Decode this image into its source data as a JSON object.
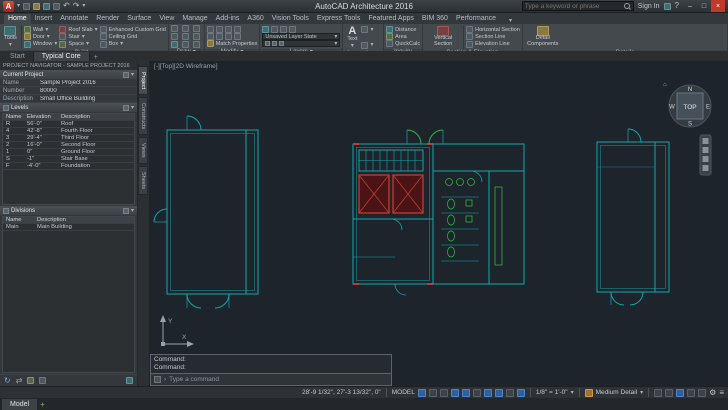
{
  "icons": {
    "caret": "▾",
    "minimize": "–",
    "maximize": "□",
    "close": "×",
    "home": "⌂",
    "gear": "⚙",
    "menu": "≡",
    "undo": "↶",
    "redo": "↷",
    "refresh": "↻",
    "sync": "⇄",
    "help": "?",
    "plus": "+",
    "prompt": "›",
    "logo": "A",
    "text_a": "A"
  },
  "titlebar": {
    "app_title": "AutoCAD Architecture 2016",
    "search_placeholder": "Type a keyword or phrase",
    "signin": "Sign In"
  },
  "ribbon": {
    "tabs": [
      "Home",
      "Insert",
      "Annotate",
      "Render",
      "Surface",
      "View",
      "Manage",
      "Add-ins",
      "A360",
      "Vision Tools",
      "Express Tools",
      "Featured Apps",
      "BIM 360",
      "Performance"
    ],
    "build": {
      "label": "Build",
      "tools": "Tools",
      "col1": [
        "Wall",
        "Door",
        "Window"
      ],
      "col2": [
        "Roof Slab",
        "Stair",
        "Space"
      ],
      "col3": [
        "Enhanced Custom Grid",
        "Ceiling Grid",
        "Box"
      ]
    },
    "draw": {
      "label": "Draw"
    },
    "modify": {
      "label": "Modify",
      "match": "Match Properties"
    },
    "layers": {
      "label": "Layers",
      "state": "Unsaved Layer State"
    },
    "annotation": {
      "label": "Annotation",
      "text_tool": "Text"
    },
    "inquiry": {
      "label": "Inquiry",
      "items": [
        "Distance",
        "Area",
        "QuickCalc"
      ]
    },
    "section": {
      "label": "Section & Elevation",
      "primary": "Vertical Section",
      "items": [
        "Horizontal Section",
        "Section Line",
        "Elevation Line"
      ]
    },
    "details": {
      "label": "Details",
      "primary": "Detail Components"
    }
  },
  "file_tabs": {
    "start": "Start",
    "active": "Typical Core"
  },
  "navigator": {
    "title": "PROJECT NAVIGATOR - SAMPLE PROJECT 2016",
    "tabs": [
      "Project",
      "Constructs",
      "Views",
      "Sheets"
    ],
    "current_project": {
      "header": "Current Project",
      "rows": [
        [
          "Name",
          "Sample Project 2016"
        ],
        [
          "Number",
          "80000"
        ],
        [
          "Description",
          "Small Office Building"
        ]
      ]
    },
    "levels": {
      "header": "Levels",
      "columns": [
        "Name",
        "Elevation",
        "Description"
      ],
      "rows": [
        [
          "R",
          "56'-0\"",
          "Roof"
        ],
        [
          "4",
          "42'-8\"",
          "Fourth Floor"
        ],
        [
          "3",
          "29'-4\"",
          "Third Floor"
        ],
        [
          "2",
          "16'-0\"",
          "Second Floor"
        ],
        [
          "1",
          "0\"",
          "Ground Floor"
        ],
        [
          "S",
          "-1\"",
          "Stair Base"
        ],
        [
          "F",
          "-4'-0\"",
          "Foundation"
        ]
      ]
    },
    "divisions": {
      "header": "Divisions",
      "columns": [
        "Name",
        "Description"
      ],
      "rows": [
        [
          "Main",
          "Main Building"
        ]
      ]
    }
  },
  "viewport": {
    "controls": "[-][Top][2D Wireframe]",
    "cube_face": "TOP",
    "north": "N",
    "south": "S",
    "east": "E",
    "west": "W",
    "axis_x": "X",
    "axis_y": "Y"
  },
  "command": {
    "line1": "Command:",
    "line2": "Command:",
    "prompt": "Type a command"
  },
  "statusbar": {
    "coords": "28'-9 1/32\", 27'-3 13/32\", 0\"",
    "model": "MODEL",
    "scale": "1/8\" = 1'-0\"",
    "detail": "Medium Detail"
  },
  "layout_tabs": {
    "model": "Model"
  }
}
